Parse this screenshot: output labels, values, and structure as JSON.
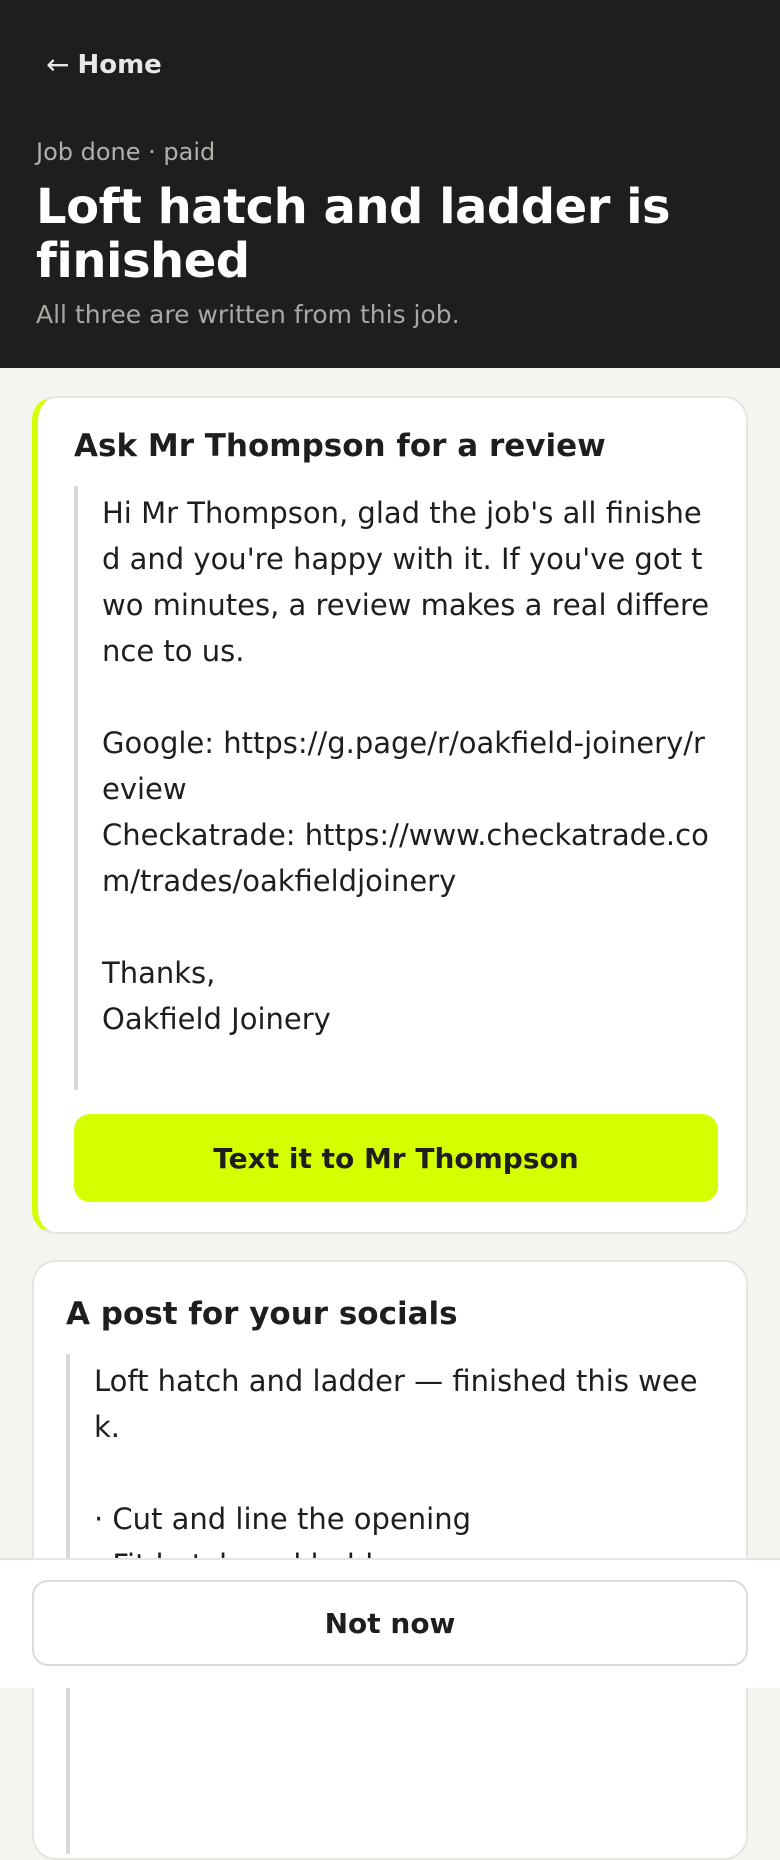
{
  "header": {
    "back_arrow": "←",
    "back_label": "Home",
    "status": "Job done · paid",
    "title": "Loft hatch and ladder is finished",
    "subtitle": "All three are written from this job."
  },
  "review_card": {
    "title": "Ask Mr Thompson for a review",
    "message": "Hi Mr Thompson, glad the job's all finished and you're happy with it. If you've got two minutes, a review makes a real difference to us.\n\nGoogle: https://g.page/r/oakfield-joinery/review\nCheckatrade: https://www.checkatrade.com/trades/oakfieldjoinery\n\nThanks,\nOakfield Joinery",
    "button_label": "Text it to Mr Thompson"
  },
  "social_card": {
    "title": "A post for your socials",
    "message": "Loft hatch and ladder — finished this week.\n\n· Cut and line the opening\n· Fit hatch and ladder"
  },
  "footer": {
    "dismiss_label": "Not now"
  },
  "colors": {
    "accent": "#d5ff00",
    "header_bg": "#1e1e1e",
    "page_bg": "#f5f4f1"
  }
}
